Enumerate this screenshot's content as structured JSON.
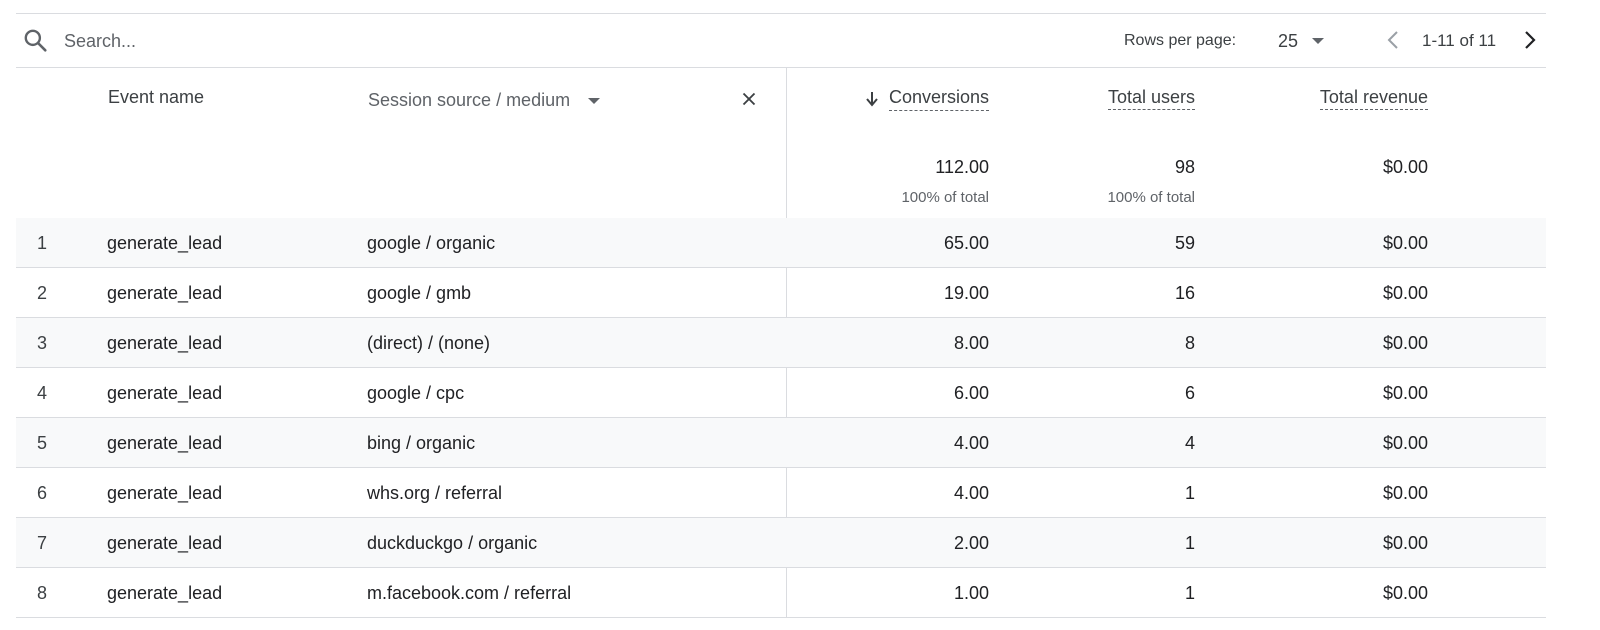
{
  "toolbar": {
    "search_placeholder": "Search...",
    "rows_per_page_label": "Rows per page:",
    "rows_per_page_value": "25",
    "page_range": "1-11 of 11"
  },
  "header": {
    "event_name": "Event name",
    "session_source": "Session source / medium",
    "conversions": "Conversions",
    "total_users": "Total users",
    "total_revenue": "Total revenue"
  },
  "totals": {
    "conversions": "112.00",
    "conversions_pct": "100% of total",
    "users": "98",
    "users_pct": "100% of total",
    "revenue": "$0.00"
  },
  "rows": [
    {
      "num": "1",
      "event": "generate_lead",
      "source": "google / organic",
      "conversions": "65.00",
      "users": "59",
      "revenue": "$0.00"
    },
    {
      "num": "2",
      "event": "generate_lead",
      "source": "google / gmb",
      "conversions": "19.00",
      "users": "16",
      "revenue": "$0.00"
    },
    {
      "num": "3",
      "event": "generate_lead",
      "source": "(direct) / (none)",
      "conversions": "8.00",
      "users": "8",
      "revenue": "$0.00"
    },
    {
      "num": "4",
      "event": "generate_lead",
      "source": "google / cpc",
      "conversions": "6.00",
      "users": "6",
      "revenue": "$0.00"
    },
    {
      "num": "5",
      "event": "generate_lead",
      "source": "bing / organic",
      "conversions": "4.00",
      "users": "4",
      "revenue": "$0.00"
    },
    {
      "num": "6",
      "event": "generate_lead",
      "source": "whs.org / referral",
      "conversions": "4.00",
      "users": "1",
      "revenue": "$0.00"
    },
    {
      "num": "7",
      "event": "generate_lead",
      "source": "duckduckgo / organic",
      "conversions": "2.00",
      "users": "1",
      "revenue": "$0.00"
    },
    {
      "num": "8",
      "event": "generate_lead",
      "source": "m.facebook.com / referral",
      "conversions": "1.00",
      "users": "1",
      "revenue": "$0.00"
    }
  ],
  "colors": {
    "border": "#dadce0",
    "row_alt": "#f8f9fa",
    "text_primary": "#202124",
    "text_secondary": "#5f6368"
  },
  "icons": [
    "search-icon",
    "caret-down-icon",
    "chevron-left-icon",
    "chevron-right-icon",
    "close-icon",
    "arrow-down-icon"
  ]
}
